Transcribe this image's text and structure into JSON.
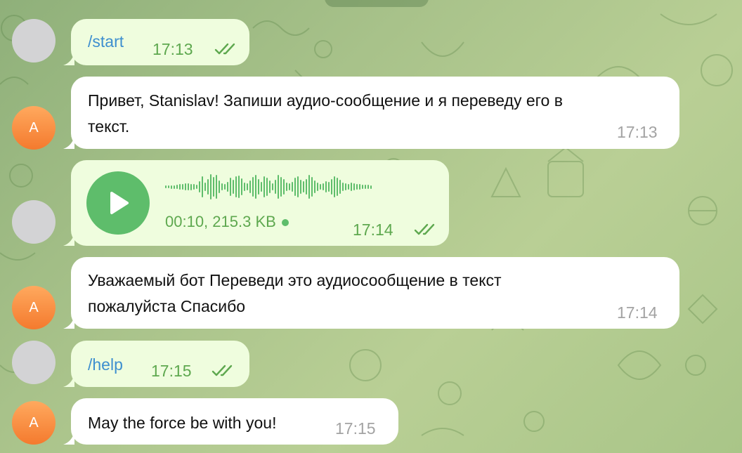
{
  "chat": {
    "messages": [
      {
        "id": "m1",
        "direction": "outgoing",
        "type": "command",
        "text": "/start",
        "time": "17:13",
        "status": "read"
      },
      {
        "id": "m2",
        "direction": "incoming",
        "type": "text",
        "text_line1": "Привет, Stanislav! Запиши аудио-сообщение и я переведу его в",
        "text_line2": "текст.",
        "time": "17:13",
        "avatar_letter": "A"
      },
      {
        "id": "m3",
        "direction": "outgoing",
        "type": "voice",
        "meta": "00:10, 215.3 KB",
        "time": "17:14",
        "status": "read"
      },
      {
        "id": "m4",
        "direction": "incoming",
        "type": "text",
        "text_line1": "Уважаемый бот Переведи это аудиосообщение в текст",
        "text_line2": "пожалуйста Спасибо",
        "time": "17:14",
        "avatar_letter": "A"
      },
      {
        "id": "m5",
        "direction": "outgoing",
        "type": "command",
        "text": "/help",
        "time": "17:15",
        "status": "read"
      },
      {
        "id": "m6",
        "direction": "incoming",
        "type": "text",
        "text_line1": "May the force be with you!",
        "time": "17:15",
        "avatar_letter": "A"
      }
    ]
  },
  "colors": {
    "outgoing_bubble": "#effdde",
    "incoming_bubble": "#ffffff",
    "command_link": "#3e8fcf",
    "outgoing_meta": "#5ea84f",
    "voice_accent": "#5ebd6b",
    "bot_avatar": "#f47a2e"
  },
  "icons": {
    "read_status": "double-check-icon",
    "voice_play": "play-icon"
  }
}
